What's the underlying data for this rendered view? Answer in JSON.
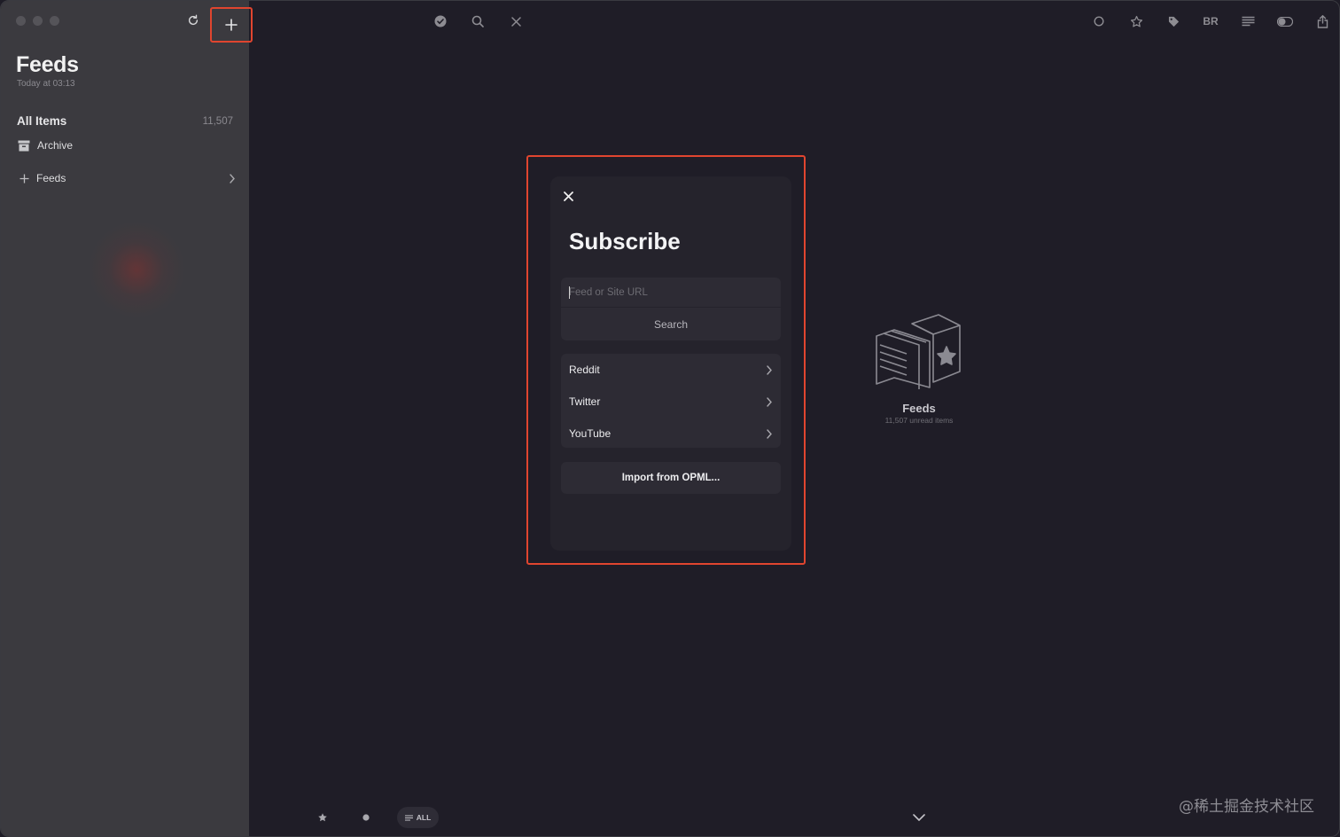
{
  "sidebar": {
    "title": "Feeds",
    "subtitle": "Today at 03:13",
    "all_items_label": "All Items",
    "all_items_count": "11,507",
    "archive_label": "Archive",
    "feeds_label": "Feeds"
  },
  "toolbar": {
    "reader_label": "BR"
  },
  "dialog": {
    "title": "Subscribe",
    "input_placeholder": "Feed or Site URL",
    "search_label": "Search",
    "items": [
      {
        "label": "Reddit"
      },
      {
        "label": "Twitter"
      },
      {
        "label": "YouTube"
      }
    ],
    "import_label": "Import from OPML..."
  },
  "empty_state": {
    "title": "Feeds",
    "subtitle": "11,507 unread items"
  },
  "bottom_bar": {
    "filter_label": "ALL"
  },
  "watermark": "@稀土掘金技术社区",
  "colors": {
    "highlight": "#e0452f",
    "sidebar_bg": "#3b3a3f",
    "main_bg": "#1f1d27",
    "dialog_bg": "#25232c"
  }
}
